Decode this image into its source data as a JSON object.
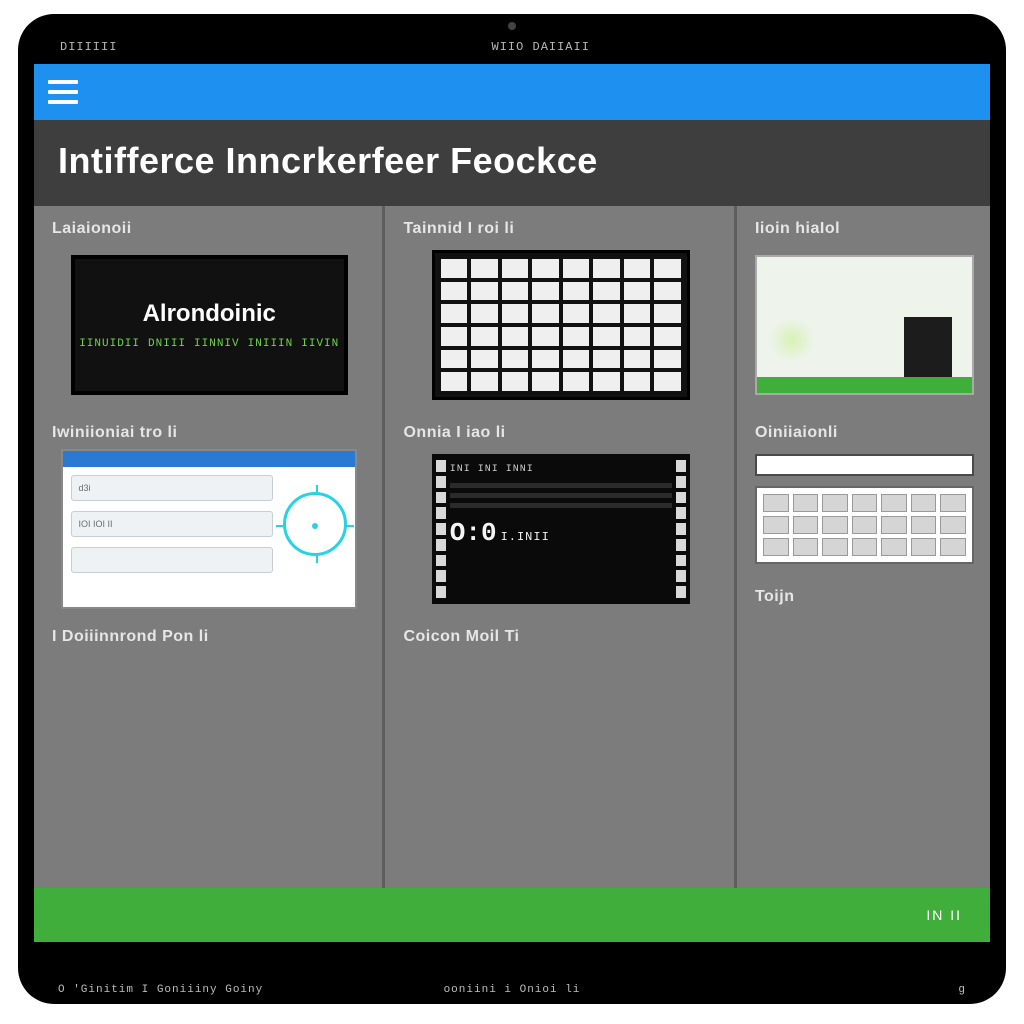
{
  "device": {
    "status_left": "DIIIIII",
    "status_center": "WIIO DAIIAII",
    "status_right": ""
  },
  "appbar": {
    "menu_icon": "hamburger-icon"
  },
  "page": {
    "title": "Intifferce Inncrkerfeer Feockce"
  },
  "cards": {
    "c1": {
      "label": "Laiaionoii",
      "tile_title": "Alrondoinic",
      "tile_sub_tokens": [
        "IINUIDII",
        "DNIII",
        "IINNIV",
        "INIIIN",
        "IIVIN"
      ]
    },
    "c2": {
      "label": "Iwiniioniai tro li",
      "window_tag": "d3i",
      "window_rows": [
        "",
        "IOI IOI II",
        ""
      ],
      "icon_name": "compass-icon"
    },
    "c3": {
      "label": "I Doiiinnrond Pon li"
    },
    "c4": {
      "label": "Tainnid I roi li",
      "grid_cols": 8,
      "grid_rows": 6
    },
    "c5": {
      "label": "Onnia I iao li",
      "code_header": "INI INI INNI",
      "code_big": "O:0",
      "code_big_suffix": "I.INII"
    },
    "c6": {
      "label": "Coicon Moil Ti"
    },
    "c7": {
      "label": "Iioin hiaIol"
    },
    "c8": {
      "label": "Oiniiaionli"
    },
    "c9": {
      "label": "Toijn"
    }
  },
  "footer": {
    "right_text": "IN II"
  },
  "bottom_status": {
    "left": "O 'Ginitim I Goniiiny Goiny",
    "center": "ooniini i Onioi li",
    "right": "g"
  },
  "colors": {
    "appbar": "#1e90f0",
    "title_band": "#3e3e3e",
    "panel": "#7c7c7c",
    "footer": "#3fae3a",
    "accent_cyan": "#26d3e4",
    "accent_green_text": "#6fd64a"
  }
}
